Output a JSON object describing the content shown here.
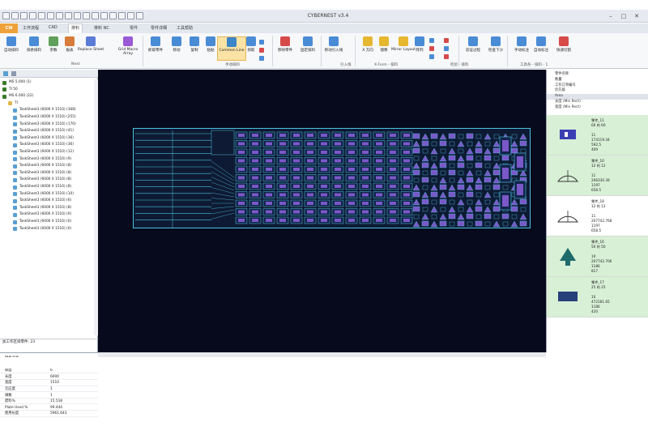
{
  "window": {
    "title": "CYBERNEST v3.4",
    "min": "–",
    "max": "□",
    "close": "✕"
  },
  "quick_access": [
    "save-icon",
    "open-icon",
    "undo-icon",
    "redo-icon",
    "zoom-icon",
    "zoom-fit-icon",
    "pan-icon",
    "grid-icon",
    "measure-icon",
    "print-icon",
    "help-icon",
    "arrow-icon",
    "select-icon",
    "layer-icon",
    "info-icon",
    "dropdown-icon"
  ],
  "menu": {
    "file_label": "CN",
    "tabs": [
      "工作流程",
      "CAD",
      "排料",
      "排料 NC",
      "零件",
      "零件详细",
      "工具帮助"
    ],
    "active_index": 2
  },
  "ribbon": {
    "buttons": [
      {
        "label": "自动排料",
        "color": "#4a8bd6"
      },
      {
        "label": "排余排料",
        "color": "#4a8bd6"
      },
      {
        "label": "参数",
        "color": "#5fa15a"
      },
      {
        "label": "报表",
        "color": "#d67b3a"
      },
      {
        "label": "Replace Sheet",
        "color": "#5a7bd6"
      },
      {
        "label": "Grid Macro Array",
        "color": "#9a5ad6"
      },
      {
        "label": "抓取零件",
        "color": "#4a8bd6"
      },
      {
        "label": "移动",
        "color": "#4a8bd6"
      },
      {
        "label": "复制",
        "color": "#4a8bd6"
      },
      {
        "label": "粘贴",
        "color": "#4a8bd6"
      },
      {
        "label": "Common Line",
        "color": "#3b86c9"
      },
      {
        "label": "抓取",
        "color": "#4a8bd6"
      },
      {
        "label": "移除零件",
        "color": "#d64a4a"
      },
      {
        "label": "固定排料",
        "color": "#4a8bd6"
      },
      {
        "label": "移动引入线",
        "color": "#4a8bd6"
      },
      {
        "label": "X 方向",
        "color": "#e6b830"
      },
      {
        "label": "镜像",
        "color": "#e6b830"
      },
      {
        "label": "Mirror Layout",
        "color": "#e6b830"
      },
      {
        "label": "阵列",
        "color": "#4a8bd6"
      },
      {
        "label": "验证过程",
        "color": "#4a8bd6"
      },
      {
        "label": "检查下沙",
        "color": "#4a8bd6"
      },
      {
        "label": "手动标注",
        "color": "#4a8bd6"
      },
      {
        "label": "自动标注",
        "color": "#4a8bd6"
      },
      {
        "label": "快速切割",
        "color": "#d64a4a"
      }
    ],
    "groups": [
      "Next",
      "手动排料",
      "引入线",
      "X-Form - 排料",
      "检验 - 排料",
      "工具条 - 排料 - 1"
    ]
  },
  "left_panel": {
    "tree": [
      {
        "label": "MS 5.000 (1)",
        "level": 0,
        "icon": "sheet-stack-icon"
      },
      {
        "label": "TI 50",
        "level": 0,
        "icon": "sheet-stack-icon"
      },
      {
        "label": "MS 6.000 (22)",
        "level": 0,
        "icon": "sheet-stack-icon"
      },
      {
        "label": "TI",
        "level": 1,
        "icon": "folder-icon"
      },
      {
        "label": "TaskSheet3 (6000 X 1510) (368)",
        "level": 2
      },
      {
        "label": "TaskSheet3 (6000 X 1510) (255)",
        "level": 2
      },
      {
        "label": "TaskSheet3 (6000 X 1510) (170)",
        "level": 2
      },
      {
        "label": "TaskSheet3 (6000 X 1510) (41)",
        "level": 2
      },
      {
        "label": "TaskSheet3 (6000 X 1510) (36)",
        "level": 2
      },
      {
        "label": "TaskSheet3 (6000 X 1510) (36)",
        "level": 2
      },
      {
        "label": "TaskSheet3 (6000 X 1510) (12)",
        "level": 2
      },
      {
        "label": "TaskSheet3 (6000 X 1510) (9)",
        "level": 2
      },
      {
        "label": "TaskSheet3 (6000 X 1510) (8)",
        "level": 2
      },
      {
        "label": "TaskSheet3 (6000 X 1510) (8)",
        "level": 2
      },
      {
        "label": "TaskSheet3 (6000 X 1510) (8)",
        "level": 2
      },
      {
        "label": "TaskSheet3 (6000 X 1510) (8)",
        "level": 2
      },
      {
        "label": "TaskSheet3 (6000 X 1510) (10)",
        "level": 2
      },
      {
        "label": "TaskSheet3 (6000 X 1510) (6)",
        "level": 2
      },
      {
        "label": "TaskSheet3 (6000 X 1510) (8)",
        "level": 2
      },
      {
        "label": "TaskSheet3 (6000 X 1510) (0)",
        "level": 2
      },
      {
        "label": "TaskSheet3 (6000 X 1510) (0)",
        "level": 2
      },
      {
        "label": "TaskSheet3 (6000 X 1510) (0)",
        "level": 2
      }
    ],
    "summary": "加工作区排零件: 23",
    "properties": [
      {
        "k": "钢板名称",
        "v": ""
      },
      {
        "k": "材料",
        "v": "MS"
      },
      {
        "k": "厚度",
        "v": "6"
      },
      {
        "k": "长度",
        "v": "6000"
      },
      {
        "k": "宽度",
        "v": "1510"
      },
      {
        "k": "无应度",
        "v": "1"
      },
      {
        "k": "填数",
        "v": "1"
      },
      {
        "k": "废料%",
        "v": "15.518"
      },
      {
        "k": "Plate Used %",
        "v": "99.444"
      },
      {
        "k": "使用长度",
        "v": "5961.643"
      }
    ]
  },
  "right_panel": {
    "headers": [
      "零件名称",
      "数量",
      "工作订单编号",
      "优先级",
      "Area",
      "长度 (Min Rect)",
      "宽度 (Min Rect)"
    ],
    "cards": [
      {
        "name": "零件_11",
        "size": "60 的 60",
        "rows": [
          "11",
          "174119.34",
          "592.5",
          "409"
        ],
        "shape": "bracket",
        "bg": "#d8f0d6"
      },
      {
        "name": "零件_10",
        "size": "12 的 12",
        "rows": [
          "11",
          "206330.39",
          "1197",
          "658.5"
        ],
        "shape": "arc",
        "bg": "#d8f0d6"
      },
      {
        "name": "零件_18",
        "size": "12 的 12",
        "rows": [
          "11",
          "207742.768",
          "1197",
          "658.5"
        ],
        "shape": "arc",
        "bg": "#ffffff"
      },
      {
        "name": "零件_16",
        "size": "50 的 50",
        "rows": [
          "10",
          "207742.706",
          "1186",
          "817"
        ],
        "shape": "stand",
        "bg": "#d8f0d6"
      },
      {
        "name": "零件_17",
        "size": "25 的 25",
        "rows": [
          "10",
          "472181.65",
          "1186",
          "420"
        ],
        "shape": "plate",
        "bg": "#d8f0d6"
      }
    ]
  },
  "colors": {
    "part_fill": "#7a58c8",
    "outline": "#4cc1e0",
    "canvas": "#060a1c",
    "sheet": "#0e1a33",
    "accent": "#f0a23a"
  }
}
